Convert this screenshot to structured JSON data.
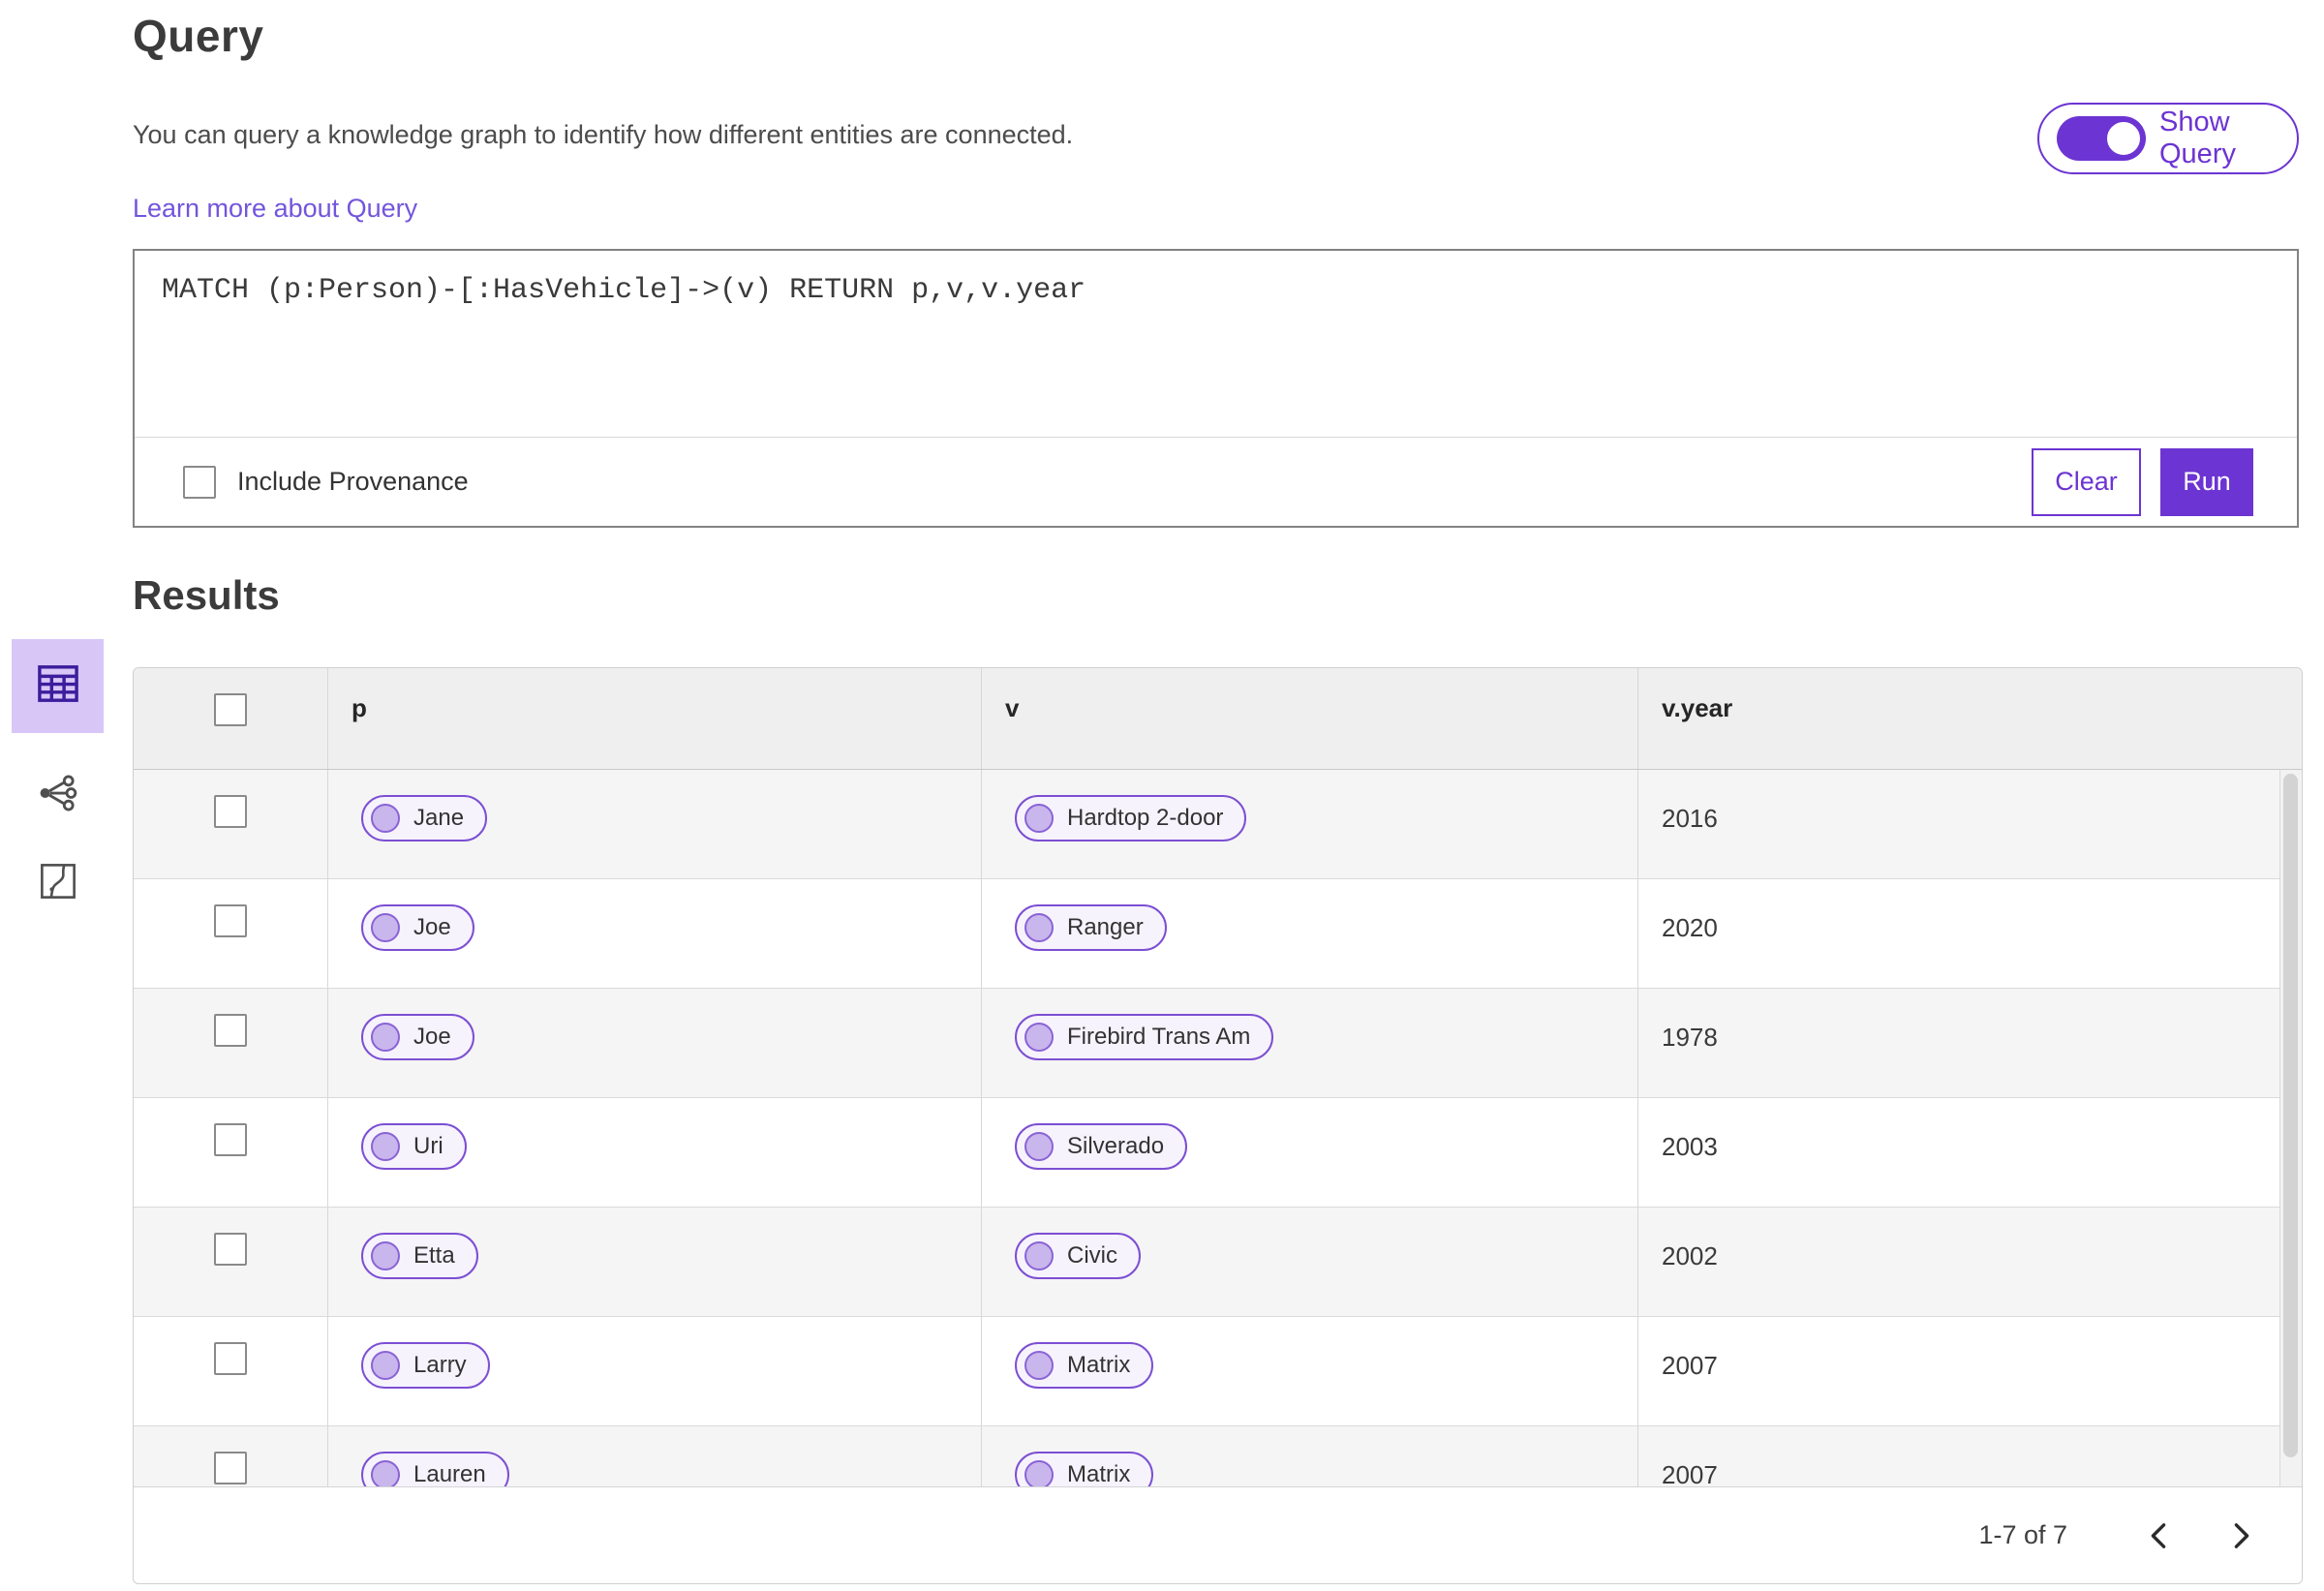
{
  "page": {
    "title": "Query",
    "description": "You can query a knowledge graph to identify how different entities are connected.",
    "learn_more_link": "Learn more about Query"
  },
  "show_query_toggle": {
    "label": "Show Query",
    "state": "on"
  },
  "query_panel": {
    "query_text": "MATCH (p:Person)-[:HasVehicle]->(v) RETURN p,v,v.year",
    "include_provenance": {
      "label": "Include Provenance",
      "checked": false
    },
    "buttons": {
      "clear": "Clear",
      "run": "Run"
    }
  },
  "results": {
    "heading": "Results",
    "view_switcher": [
      {
        "id": "table-view",
        "icon": "table-view-icon",
        "selected": true
      },
      {
        "id": "network-view",
        "icon": "network-view-icon",
        "selected": false
      },
      {
        "id": "map-view",
        "icon": "map-view-icon",
        "selected": false
      }
    ],
    "table": {
      "columns": [
        "p",
        "v",
        "v.year"
      ],
      "select_all_checked": false,
      "rows": [
        {
          "checked": false,
          "p": "Jane",
          "v": "Hardtop 2-door",
          "year": "2016"
        },
        {
          "checked": false,
          "p": "Joe",
          "v": "Ranger",
          "year": "2020"
        },
        {
          "checked": false,
          "p": "Joe",
          "v": "Firebird Trans Am",
          "year": "1978"
        },
        {
          "checked": false,
          "p": "Uri",
          "v": "Silverado",
          "year": "2003"
        },
        {
          "checked": false,
          "p": "Etta",
          "v": "Civic",
          "year": "2002"
        },
        {
          "checked": false,
          "p": "Larry",
          "v": "Matrix",
          "year": "2007"
        },
        {
          "checked": false,
          "p": "Lauren",
          "v": "Matrix",
          "year": "2007"
        }
      ]
    },
    "pagination": {
      "range_label": "1-7 of 7",
      "prev_icon": "chevron-left-icon",
      "next_icon": "chevron-right-icon"
    }
  },
  "colors": {
    "accent": "#6c34d2",
    "accent_tile": "#d8c6f7",
    "link": "#7355dc",
    "pill_border": "#7c4fd3",
    "pill_fill": "#f6f3fd",
    "pill_dot": "#c9b6ec",
    "header_bg": "#efefef",
    "row_alt_bg": "#f5f5f5",
    "table_border": "#d7d7d7"
  }
}
